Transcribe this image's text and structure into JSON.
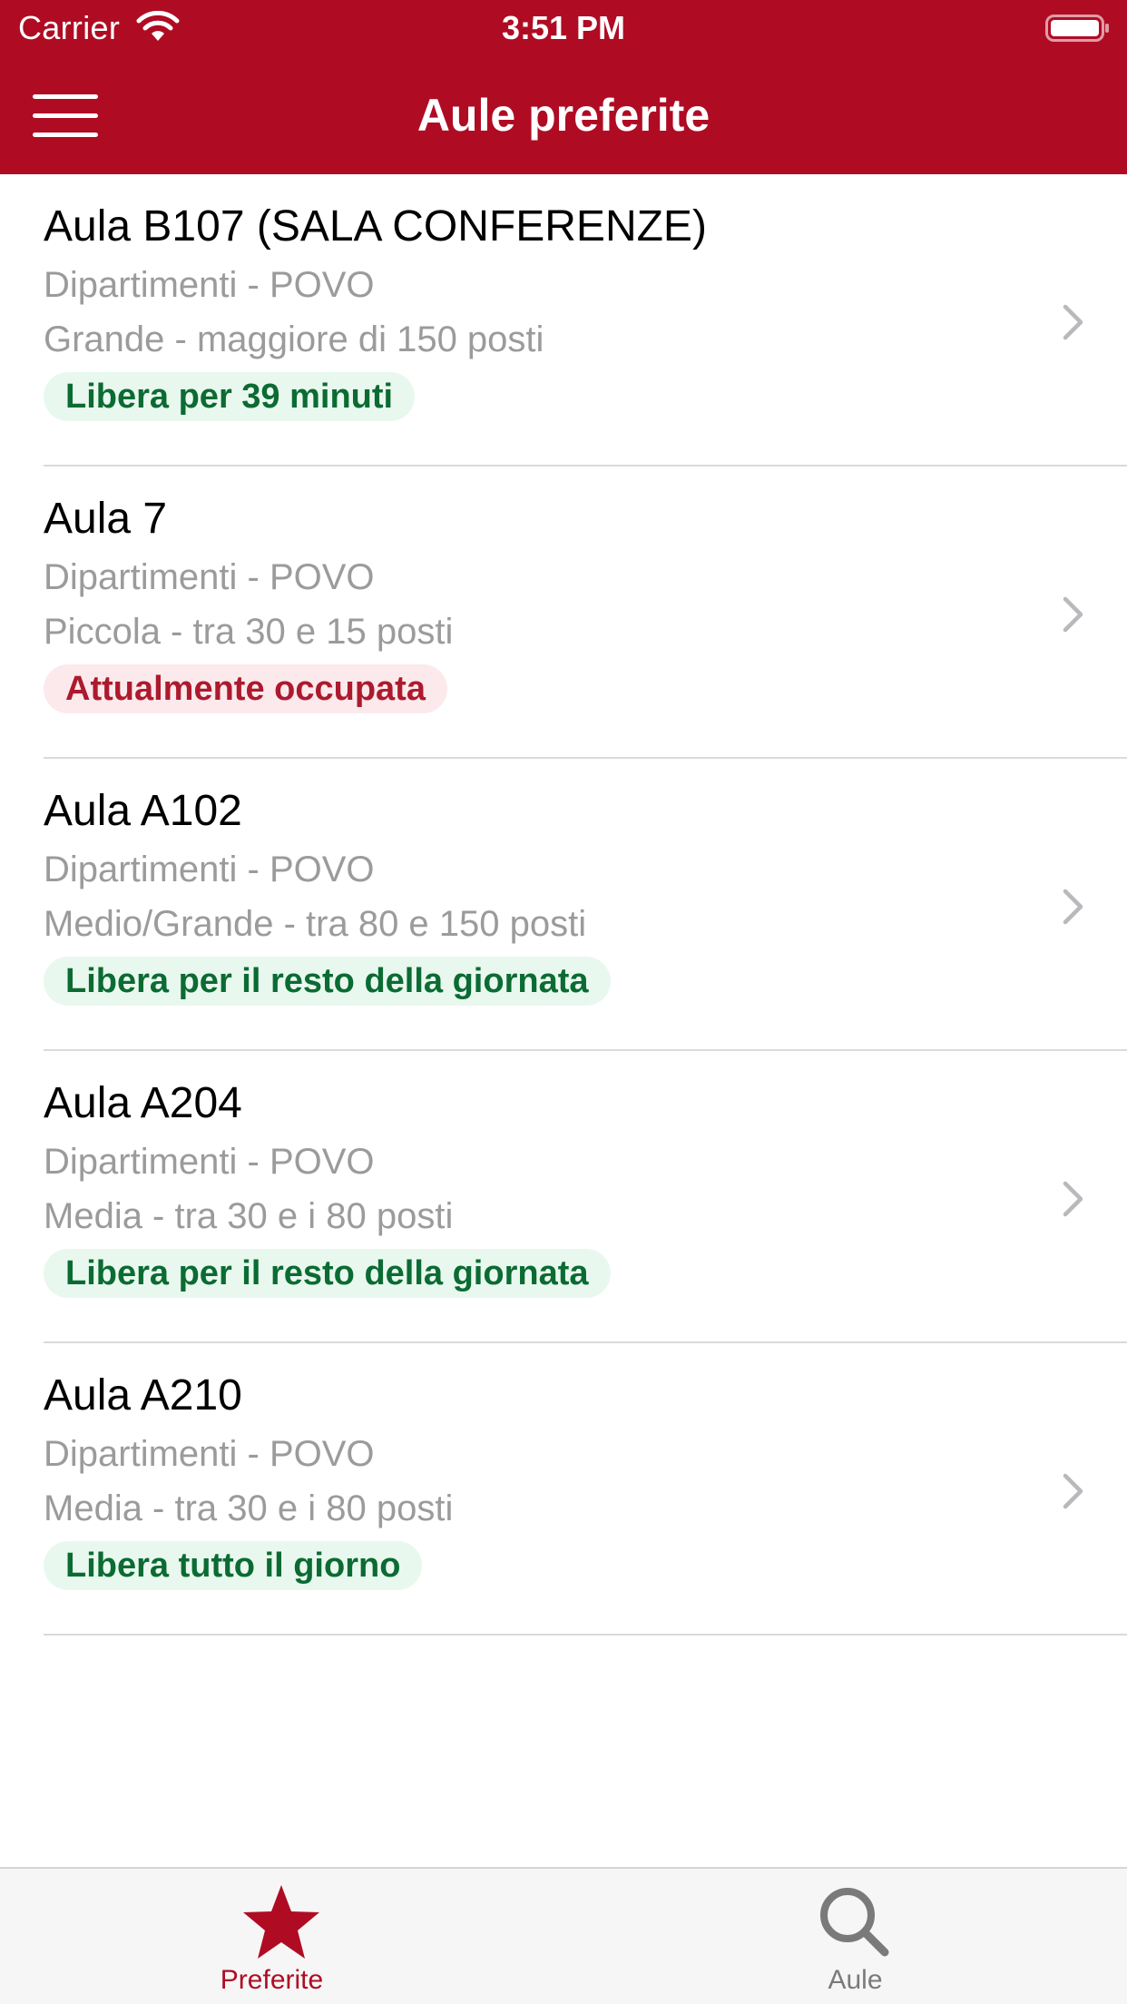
{
  "status_bar": {
    "carrier": "Carrier",
    "time": "3:51 PM"
  },
  "nav": {
    "title": "Aule preferite"
  },
  "colors": {
    "brand": "#AF0C24",
    "free_bg": "#E9F8EE",
    "free_fg": "#0B6B33",
    "busy_bg": "#FCE9EC",
    "busy_fg": "#AC1A2E",
    "secondary_text": "#9B9B9B"
  },
  "rooms": [
    {
      "name": "Aula B107 (SALA CONFERENZE)",
      "location": "Dipartimenti - POVO",
      "size": "Grande - maggiore di 150 posti",
      "status": "Libera per 39 minuti",
      "status_type": "free"
    },
    {
      "name": "Aula 7",
      "location": "Dipartimenti - POVO",
      "size": "Piccola - tra 30 e 15 posti",
      "status": "Attualmente occupata",
      "status_type": "busy"
    },
    {
      "name": "Aula A102",
      "location": "Dipartimenti - POVO",
      "size": "Medio/Grande - tra 80 e 150 posti",
      "status": "Libera per il resto della giornata",
      "status_type": "free"
    },
    {
      "name": "Aula A204",
      "location": "Dipartimenti - POVO",
      "size": "Media - tra 30 e i 80 posti",
      "status": "Libera per il resto della giornata",
      "status_type": "free"
    },
    {
      "name": "Aula A210",
      "location": "Dipartimenti - POVO",
      "size": "Media - tra 30 e i 80 posti",
      "status": "Libera tutto il giorno",
      "status_type": "free"
    }
  ],
  "tabbar": {
    "tabs": [
      {
        "label": "Preferite",
        "icon": "star-icon",
        "selected": true
      },
      {
        "label": "Aule",
        "icon": "search-icon",
        "selected": false
      }
    ]
  }
}
